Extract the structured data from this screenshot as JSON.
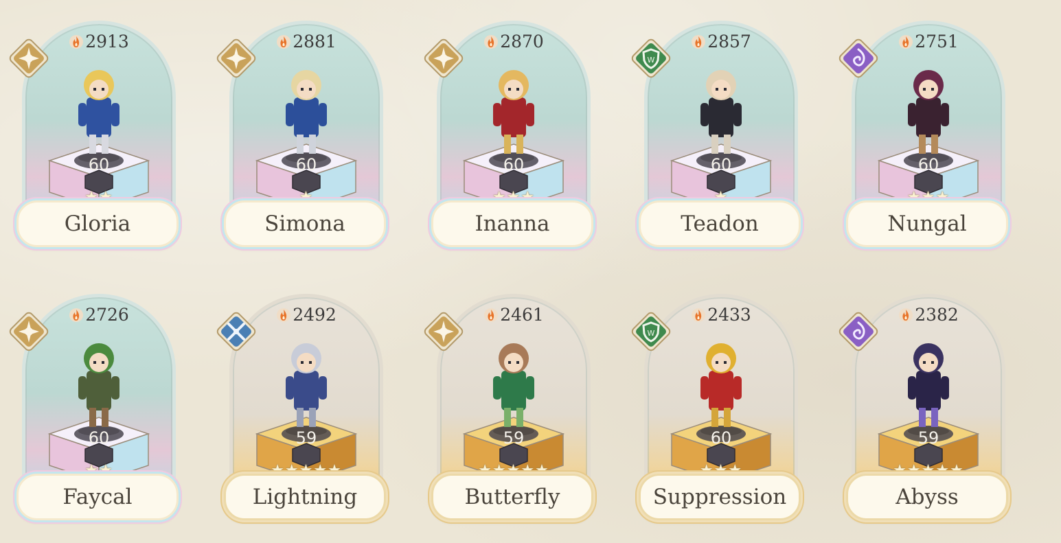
{
  "colors": {
    "background": "#ece6d6",
    "name_text": "#4a443b",
    "power_text": "#3b3a3a",
    "flame": "#e8742a",
    "badge_gold": "#c9a25a",
    "badge_green": "#3f8a4e",
    "badge_purple": "#8a5fc4",
    "badge_blue": "#4a7fb4"
  },
  "heroes": [
    {
      "name": "Gloria",
      "power": "2913",
      "level": "60",
      "stars": "★★",
      "class_icon": "star-emblem-icon",
      "pedestal": "rainbow"
    },
    {
      "name": "Simona",
      "power": "2881",
      "level": "60",
      "stars": "★",
      "class_icon": "star-emblem-icon",
      "pedestal": "rainbow"
    },
    {
      "name": "Inanna",
      "power": "2870",
      "level": "60",
      "stars": "★★★",
      "class_icon": "star-emblem-icon",
      "pedestal": "rainbow"
    },
    {
      "name": "Teadon",
      "power": "2857",
      "level": "60",
      "stars": "★",
      "class_icon": "shield-emblem-icon",
      "pedestal": "rainbow"
    },
    {
      "name": "Nungal",
      "power": "2751",
      "level": "60",
      "stars": "★★★",
      "class_icon": "swirl-emblem-icon",
      "pedestal": "rainbow"
    },
    {
      "name": "Faycal",
      "power": "2726",
      "level": "60",
      "stars": "★★",
      "class_icon": "star-emblem-icon",
      "pedestal": "rainbow"
    },
    {
      "name": "Lightning",
      "power": "2492",
      "level": "59",
      "stars": "★★★★★",
      "class_icon": "cross-blades-emblem-icon",
      "pedestal": "gold"
    },
    {
      "name": "Butterfly",
      "power": "2461",
      "level": "59",
      "stars": "★★★★★",
      "class_icon": "star-emblem-icon",
      "pedestal": "gold"
    },
    {
      "name": "Suppression",
      "power": "2433",
      "level": "60",
      "stars": "★★★",
      "class_icon": "shield-emblem-icon",
      "pedestal": "gold"
    },
    {
      "name": "Abyss",
      "power": "2382",
      "level": "59",
      "stars": "★★★★★",
      "class_icon": "swirl-emblem-icon",
      "pedestal": "gold"
    }
  ]
}
